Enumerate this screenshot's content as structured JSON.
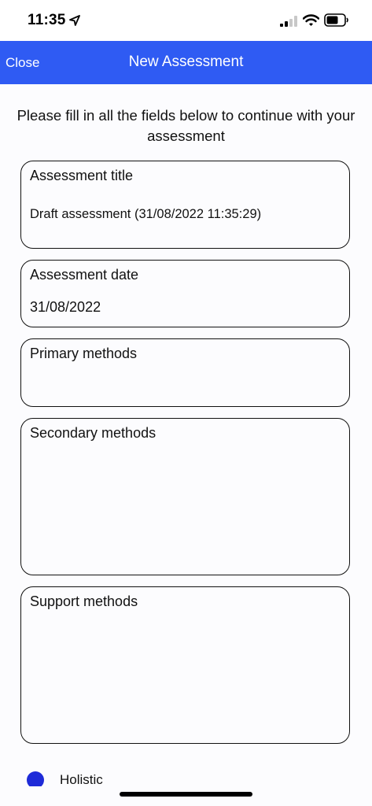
{
  "status_bar": {
    "time": "11:35"
  },
  "nav": {
    "close_label": "Close",
    "title": "New Assessment"
  },
  "instructions": "Please fill in all the fields below to continue with your assessment",
  "form": {
    "title_field": {
      "label": "Assessment title",
      "value": "Draft assessment (31/08/2022 11:35:29)"
    },
    "date_field": {
      "label": "Assessment date",
      "value": "31/08/2022"
    },
    "primary_field": {
      "label": "Primary methods",
      "value": ""
    },
    "secondary_field": {
      "label": "Secondary methods",
      "value": ""
    },
    "support_field": {
      "label": "Support methods",
      "value": ""
    }
  },
  "bottom_option": {
    "label": "Holistic",
    "selected": true
  },
  "colors": {
    "nav_background": "#2f5bf3",
    "radio_selected": "#1e2bd8"
  },
  "icons": [
    "location-arrow-icon",
    "cellular-signal-icon",
    "wifi-icon",
    "battery-icon"
  ]
}
